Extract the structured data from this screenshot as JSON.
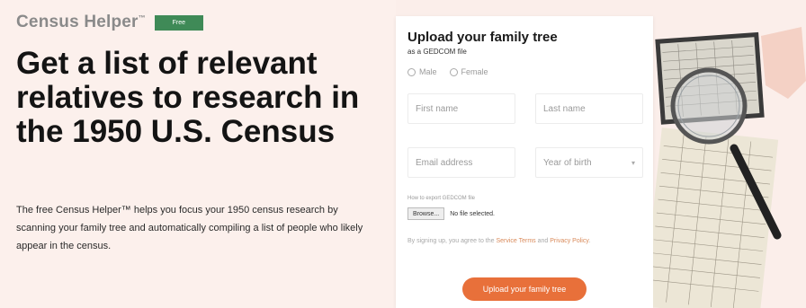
{
  "brand": {
    "name": "Census Helper",
    "tm": "™",
    "badge": "Free"
  },
  "hero": {
    "headline": "Get a list of relevant relatives to research in the 1950 U.S. Census",
    "description": "The free Census Helper™ helps you focus your 1950 census research by scanning your family tree and automatically compiling a list of people who likely appear in the census."
  },
  "form": {
    "title": "Upload your family tree",
    "subtitle": "as a GEDCOM file",
    "sex_options": [
      "Male",
      "Female"
    ],
    "first_name_placeholder": "First name",
    "last_name_placeholder": "Last name",
    "email_placeholder": "Email address",
    "year_placeholder": "Year of birth",
    "file_label": "How to export GEDCOM file",
    "browse_label": "Browse...",
    "no_file_text": "No file selected.",
    "terms_prefix": "By signing up, you agree to the ",
    "terms_link1": "Service Terms",
    "terms_and": " and ",
    "terms_link2": "Privacy Policy",
    "terms_suffix": ".",
    "submit_label": "Upload your family tree"
  },
  "colors": {
    "accent": "#e8703a",
    "badge": "#3f8a57",
    "hero_bg": "#fcf0ec"
  },
  "icons": {
    "select": "chevron-down-icon",
    "art": "magnifying-glass-icon"
  }
}
